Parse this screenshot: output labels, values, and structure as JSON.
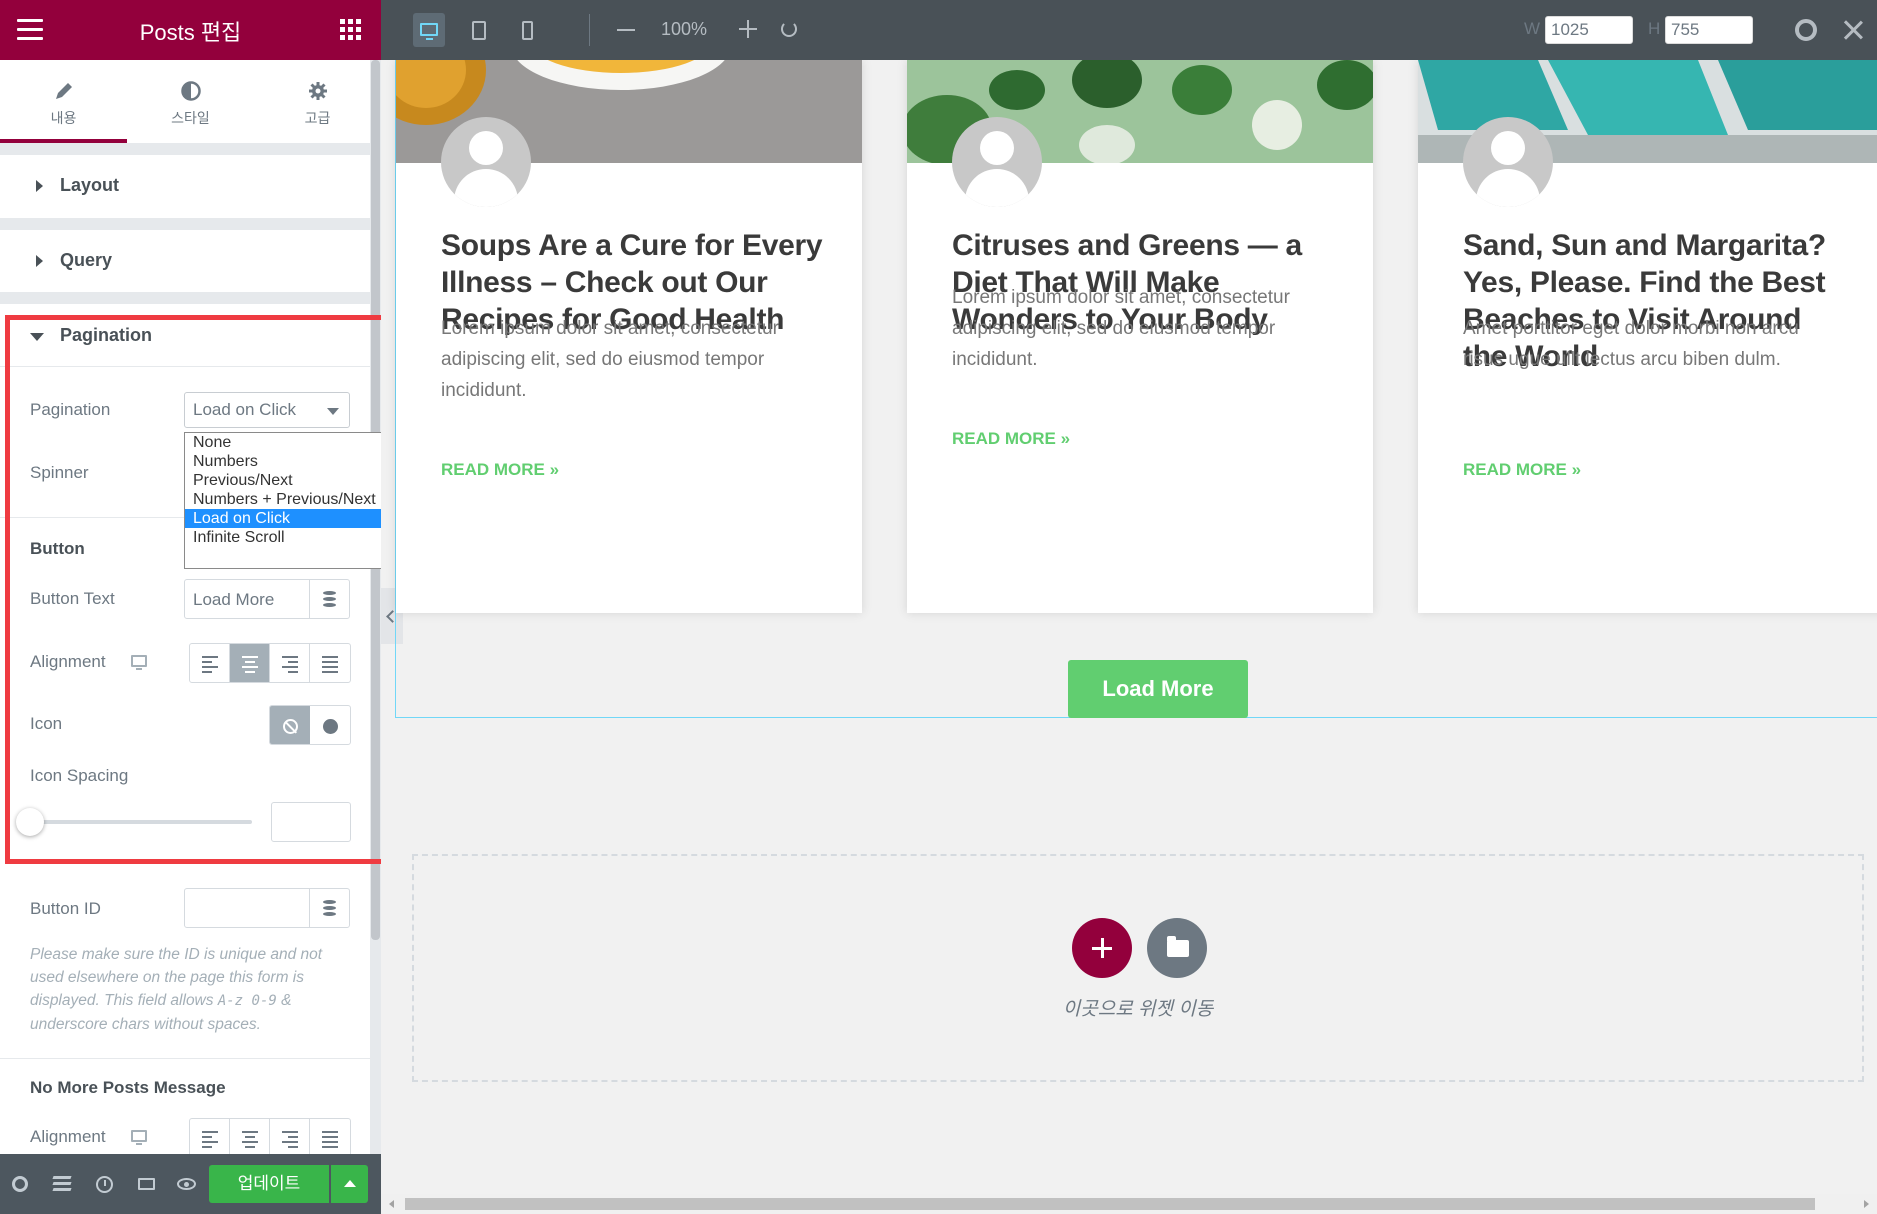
{
  "panel": {
    "title": "Posts 편집",
    "tabs": [
      {
        "label": "내용",
        "icon": "pencil-icon"
      },
      {
        "label": "스타일",
        "icon": "half-circle-icon"
      },
      {
        "label": "고급",
        "icon": "gear-icon"
      }
    ],
    "sections": {
      "layout": "Layout",
      "query": "Query",
      "pagination": "Pagination"
    },
    "controls": {
      "pagination_label": "Pagination",
      "pagination_value": "Load on Click",
      "pagination_options": [
        "None",
        "Numbers",
        "Previous/Next",
        "Numbers + Previous/Next",
        "Load on Click",
        "Infinite Scroll"
      ],
      "spinner_label": "Spinner",
      "button_heading": "Button",
      "button_text_label": "Button Text",
      "button_text_value": "Load More",
      "alignment_label": "Alignment",
      "icon_label": "Icon",
      "icon_spacing_label": "Icon Spacing",
      "button_id_label": "Button ID",
      "help_text_1": "Please make sure the ID is unique and not used elsewhere on the page this form is displayed. This field allows ",
      "help_code": "A-z 0-9",
      "help_text_2": " & underscore chars without spaces.",
      "no_more_heading": "No More Posts Message",
      "alignment_label_2": "Alignment"
    },
    "footer": {
      "update_label": "업데이트"
    },
    "accent_color": "#93003c",
    "highlight_color": "#ef3b41"
  },
  "toolbar": {
    "zoom": "100%",
    "width_label": "W",
    "width_value": "1025",
    "height_label": "H",
    "height_value": "755"
  },
  "posts": [
    {
      "title": "Soups Are a Cure for Every Illness – Check out Our Recipes for Good Health",
      "excerpt": "Lorem ipsum dolor sit amet, consectetur adipiscing elit, sed do eiusmod tempor incididunt.",
      "read_more": "READ MORE »"
    },
    {
      "title": "Citruses and Greens — a Diet That Will Make Wonders to Your Body",
      "excerpt": "Lorem ipsum dolor sit amet, consectetur adipiscing elit, sed do eiusmod tempor incididunt.",
      "read_more": "READ MORE »"
    },
    {
      "title": "Sand, Sun and Margarita? Yes, Please. Find the Best Beaches to Visit Around the World",
      "excerpt": "Amet porttitor eget dolor morbi non arcu risus ugue ullt lectus arcu biben dulm.",
      "read_more": "READ MORE »"
    }
  ],
  "load_more_label": "Load More",
  "dropzone_text": "이곳으로 위젯 이동",
  "button_color": "#61ce70"
}
